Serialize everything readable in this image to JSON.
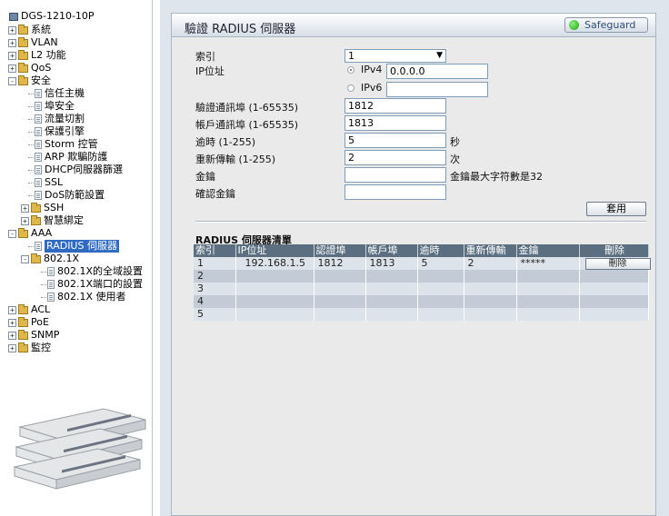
{
  "tree": {
    "root": "DGS-1210-10P",
    "items": [
      {
        "label": "系統",
        "exp": "+"
      },
      {
        "label": "VLAN",
        "exp": "+"
      },
      {
        "label": "L2 功能",
        "exp": "+"
      },
      {
        "label": "QoS",
        "exp": "+"
      },
      {
        "label": "安全",
        "exp": "-"
      },
      {
        "label": "信任主機"
      },
      {
        "label": "埠安全"
      },
      {
        "label": "流量切割"
      },
      {
        "label": "保護引擎"
      },
      {
        "label": "Storm 控管"
      },
      {
        "label": "ARP 欺騙防護"
      },
      {
        "label": "DHCP伺服器篩選"
      },
      {
        "label": "SSL"
      },
      {
        "label": "DoS防範設置"
      },
      {
        "label": "SSH",
        "exp": "+"
      },
      {
        "label": "智慧綁定",
        "exp": "+"
      },
      {
        "label": "AAA",
        "exp": "-"
      },
      {
        "label": "RADIUS 伺服器"
      },
      {
        "label": "802.1X",
        "exp": "-"
      },
      {
        "label": "802.1X的全域設置"
      },
      {
        "label": "802.1X端口的設置"
      },
      {
        "label": "802.1X 使用者"
      },
      {
        "label": "ACL",
        "exp": "+"
      },
      {
        "label": "PoE",
        "exp": "+"
      },
      {
        "label": "SNMP",
        "exp": "+"
      },
      {
        "label": "監控",
        "exp": "+"
      }
    ]
  },
  "panel": {
    "title": "驗證 RADIUS 伺服器",
    "safeguard": "Safeguard"
  },
  "form": {
    "index_label": "索引",
    "index_value": "1",
    "ip_label": "IP位址",
    "ipv4_label": "IPv4",
    "ipv4_value": "0.0.0.0",
    "ipv6_label": "IPv6",
    "ipv6_value": "",
    "auth_port_label": "驗證通訊埠 (1-65535)",
    "auth_port_value": "1812",
    "acct_port_label": "帳戶通訊埠 (1-65535)",
    "acct_port_value": "1813",
    "timeout_label": "逾時 (1-255)",
    "timeout_value": "5",
    "timeout_unit": "秒",
    "retransmit_label": "重新傳輸 (1-255)",
    "retransmit_value": "2",
    "retransmit_unit": "次",
    "key_label": "金鑰",
    "key_value": "",
    "key_hint": "金鑰最大字符數是32",
    "confirm_key_label": "確認金鑰",
    "confirm_key_value": "",
    "apply_button": "套用"
  },
  "table": {
    "title": "RADIUS 伺服器清單",
    "columns": [
      "索引",
      "IP位址",
      "認證埠",
      "帳戶埠",
      "逾時",
      "重新傳輸",
      "金鑰",
      "刪除"
    ],
    "rows": [
      [
        "1",
        "192.168.1.5",
        "1812",
        "1813",
        "5",
        "2",
        "*****",
        "刪除"
      ],
      [
        "2",
        "",
        "",
        "",
        "",
        "",
        "",
        ""
      ],
      [
        "3",
        "",
        "",
        "",
        "",
        "",
        "",
        ""
      ],
      [
        "4",
        "",
        "",
        "",
        "",
        "",
        "",
        ""
      ],
      [
        "5",
        "",
        "",
        "",
        "",
        "",
        "",
        ""
      ]
    ]
  }
}
